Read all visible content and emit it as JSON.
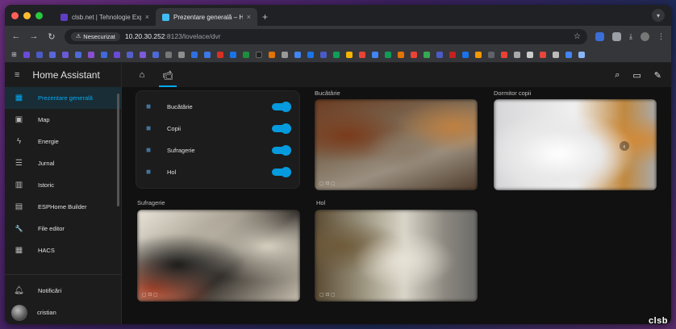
{
  "browser": {
    "tabs": [
      {
        "title": "clsb.net | Tehnologie Explicată",
        "favicon_color": "#5f3dc4"
      },
      {
        "title": "Prezentare generală – Home Assistant",
        "favicon_color": "#41bdf5"
      }
    ],
    "new_tab": "+",
    "tab_close": "×",
    "security_label": "Nesecurizat",
    "url_host": "10.20.30.252",
    "url_rest": ":8123/lovelace/dvr"
  },
  "ha": {
    "app_title": "Home Assistant",
    "sidebar": {
      "items": [
        {
          "label": "Prezentare generală",
          "icon": "dashboard-icon",
          "glyph": "▦",
          "active": true
        },
        {
          "label": "Map",
          "icon": "map-icon",
          "glyph": "▣"
        },
        {
          "label": "Energie",
          "icon": "lightning-icon",
          "glyph": "ϟ"
        },
        {
          "label": "Jurnal",
          "icon": "logbook-icon",
          "glyph": "☰"
        },
        {
          "label": "Istoric",
          "icon": "history-icon",
          "glyph": "▥"
        },
        {
          "label": "ESPHome Builder",
          "icon": "esphome-icon",
          "glyph": "▤"
        },
        {
          "label": "File editor",
          "icon": "wrench-icon",
          "glyph": "🔧"
        },
        {
          "label": "HACS",
          "icon": "hacs-icon",
          "glyph": "▦"
        }
      ],
      "notifications_label": "Notificări",
      "user_name": "cristian"
    },
    "entities": [
      {
        "label": "Bucătărie",
        "state": "on"
      },
      {
        "label": "Copii",
        "state": "on"
      },
      {
        "label": "Sufragerie",
        "state": "on"
      },
      {
        "label": "Hol",
        "state": "on"
      }
    ],
    "cameras": {
      "kitchen": "Bucătărie",
      "kids_room": "Dormitor copii",
      "living_room": "Sufragerie",
      "hall": "Hol"
    },
    "accent_color": "#03a9f4"
  },
  "watermark": "clsb"
}
